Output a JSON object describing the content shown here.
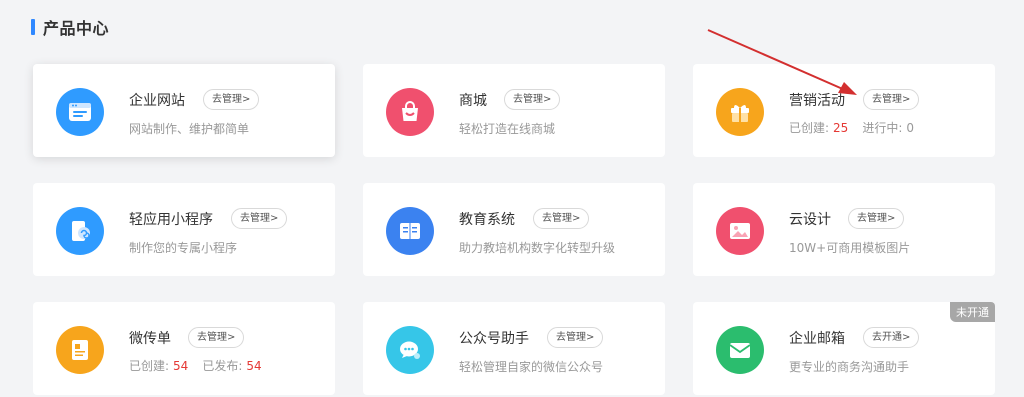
{
  "section": {
    "title": "产品中心"
  },
  "colors": {
    "accent": "#2f88ff",
    "highlight_number": "#e53935",
    "annotation_arrow": "#d32f2f"
  },
  "cards": [
    {
      "name": "企业网站",
      "button": "去管理>",
      "desc": "网站制作、维护都简单",
      "icon": "website-icon"
    },
    {
      "name": "商城",
      "button": "去管理>",
      "desc": "轻松打造在线商城",
      "icon": "shopping-bag-icon"
    },
    {
      "name": "营销活动",
      "button": "去管理>",
      "icon": "gift-icon",
      "stats": {
        "created_label": "已创建:",
        "created_value": "25",
        "ongoing_label": "进行中:",
        "ongoing_value": "0"
      }
    },
    {
      "name": "轻应用小程序",
      "button": "去管理>",
      "desc": "制作您的专属小程序",
      "icon": "mini-program-icon"
    },
    {
      "name": "教育系统",
      "button": "去管理>",
      "desc": "助力教培机构数字化转型升级",
      "icon": "book-icon"
    },
    {
      "name": "云设计",
      "button": "去管理>",
      "desc": "10W+可商用模板图片",
      "icon": "image-icon"
    },
    {
      "name": "微传单",
      "button": "去管理>",
      "icon": "flyer-icon",
      "stats": {
        "created_label": "已创建:",
        "created_value": "54",
        "published_label": "已发布:",
        "published_value": "54"
      }
    },
    {
      "name": "公众号助手",
      "button": "去管理>",
      "desc": "轻松管理自家的微信公众号",
      "icon": "wechat-icon"
    },
    {
      "name": "企业邮箱",
      "button": "去开通>",
      "desc": "更专业的商务沟通助手",
      "icon": "mail-icon",
      "badge": "未开通"
    }
  ]
}
